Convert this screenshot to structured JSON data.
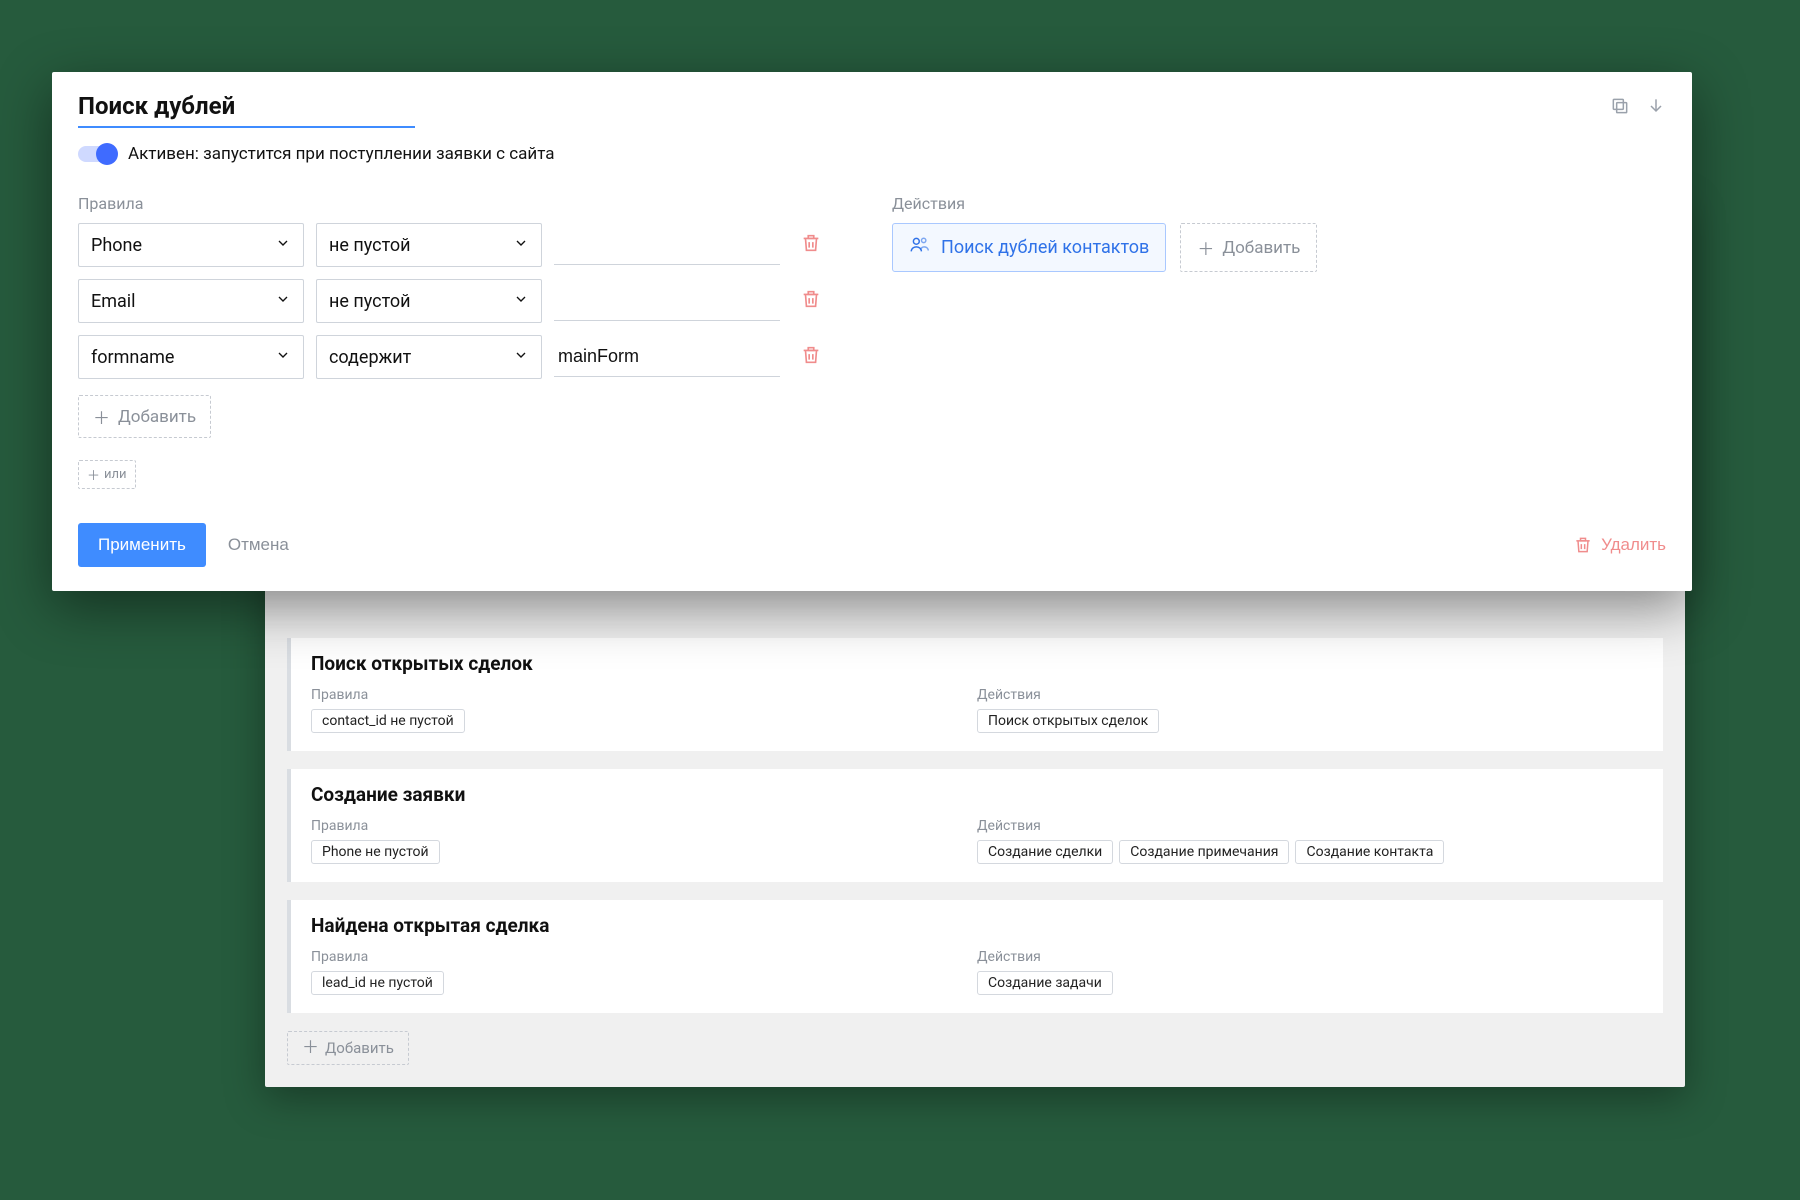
{
  "editor": {
    "title": "Поиск дублей",
    "active_label": "Активен: запустится при поступлении заявки с сайта",
    "rules_label": "Правила",
    "actions_label": "Действия",
    "rules": [
      {
        "field": "Phone",
        "operator": "не пустой",
        "value": ""
      },
      {
        "field": "Email",
        "operator": "не пустой",
        "value": ""
      },
      {
        "field": "formname",
        "operator": "содержит",
        "value": "mainForm"
      }
    ],
    "add_rule": "Добавить",
    "or_label": "или",
    "action_pill": "Поиск дублей контактов",
    "action_add": "Добавить",
    "apply": "Применить",
    "cancel": "Отмена",
    "delete": "Удалить"
  },
  "cards": [
    {
      "title": "Поиск открытых сделок",
      "rules_label": "Правила",
      "actions_label": "Действия",
      "rule_tags": [
        "contact_id не пустой"
      ],
      "action_tags": [
        "Поиск открытых сделок"
      ]
    },
    {
      "title": "Создание заявки",
      "rules_label": "Правила",
      "actions_label": "Действия",
      "rule_tags": [
        "Phone не пустой"
      ],
      "action_tags": [
        "Создание сделки",
        "Создание примечания",
        "Создание контакта"
      ]
    },
    {
      "title": "Найдена открытая сделка",
      "rules_label": "Правила",
      "actions_label": "Действия",
      "rule_tags": [
        "lead_id не пустой"
      ],
      "action_tags": [
        "Создание задачи"
      ]
    }
  ],
  "bg_add": "Добавить"
}
